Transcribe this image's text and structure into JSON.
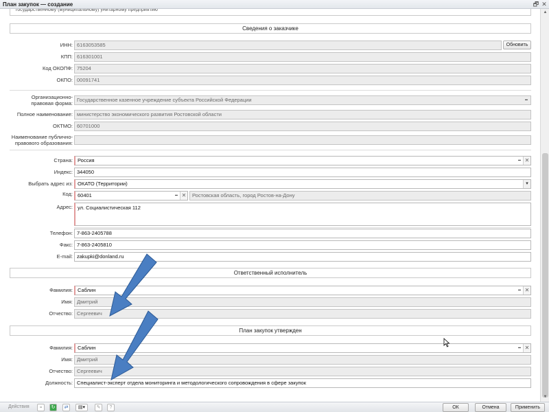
{
  "window": {
    "title": "План закупок — создание",
    "restore_glyph": "🗗",
    "close_glyph": "✕"
  },
  "top_clip_text": "государственному (муниципальному) унитарному предприятию",
  "customer": {
    "section_title": "Сведения о заказчике",
    "inn_label": "ИНН:",
    "inn": "6163053585",
    "refresh_button": "Обновить",
    "kpp_label": "КПП:",
    "kpp": "616301001",
    "okopf_label": "Код ОКОПФ:",
    "okopf": "75204",
    "okpo_label": "ОКПО:",
    "okpo": "00091741",
    "orgform_label": "Организационно-правовая форма:",
    "orgform": "Государственное казенное учреждение субъекта Российской Федерации",
    "fullname_label": "Полное наименование:",
    "fullname": "министерство экономического развития Ростовской области",
    "oktmo_label": "ОКТМО:",
    "oktmo": "60701000",
    "municipal_label": "Наименование публично-правового образования:",
    "municipal": "",
    "country_label": "Страна:",
    "country": "Россия",
    "index_label": "Индекс:",
    "index": "344050",
    "address_from_label": "Выбрать адрес из:",
    "address_from": "ОКАТО (Территории)",
    "code_label": "Код:",
    "code": "60401",
    "code_desc": "Ростовская область, город Ростов-на-Дону",
    "address_label": "Адрес:",
    "address": "ул. Социалистическая 112",
    "phone_label": "Телефон:",
    "phone": "7-863-2405788",
    "fax_label": "Факс:",
    "fax": "7-863-2405810",
    "email_label": "E-mail:",
    "email": "zakupki@donland.ru"
  },
  "executor": {
    "section_title": "Ответственный исполнитель",
    "lastname_label": "Фамилия:",
    "lastname": "Саблин",
    "firstname_label": "Имя:",
    "firstname": "Дмитрий",
    "middlename_label": "Отчество:",
    "middlename": "Сергеевич"
  },
  "approved": {
    "section_title": "План закупок утвержден",
    "lastname_label": "Фамилия:",
    "lastname": "Саблин",
    "firstname_label": "Имя:",
    "firstname": "Дмитрий",
    "middlename_label": "Отчество:",
    "middlename": "Сергеевич",
    "position_label": "Должность:",
    "position": "Специалист-эксперт отдела мониторинга и методологического сопровождения в сфере закупок"
  },
  "footer": {
    "actions_label": "Действия",
    "ok_button": "ОК",
    "cancel_button": "Отмена",
    "apply_button": "Применить"
  },
  "glyphs": {
    "dots": "...",
    "clear": "✕",
    "dropdown": "▾"
  },
  "colors": {
    "arrow_fill": "#4a7ec2",
    "arrow_stroke": "#2c5a96"
  }
}
